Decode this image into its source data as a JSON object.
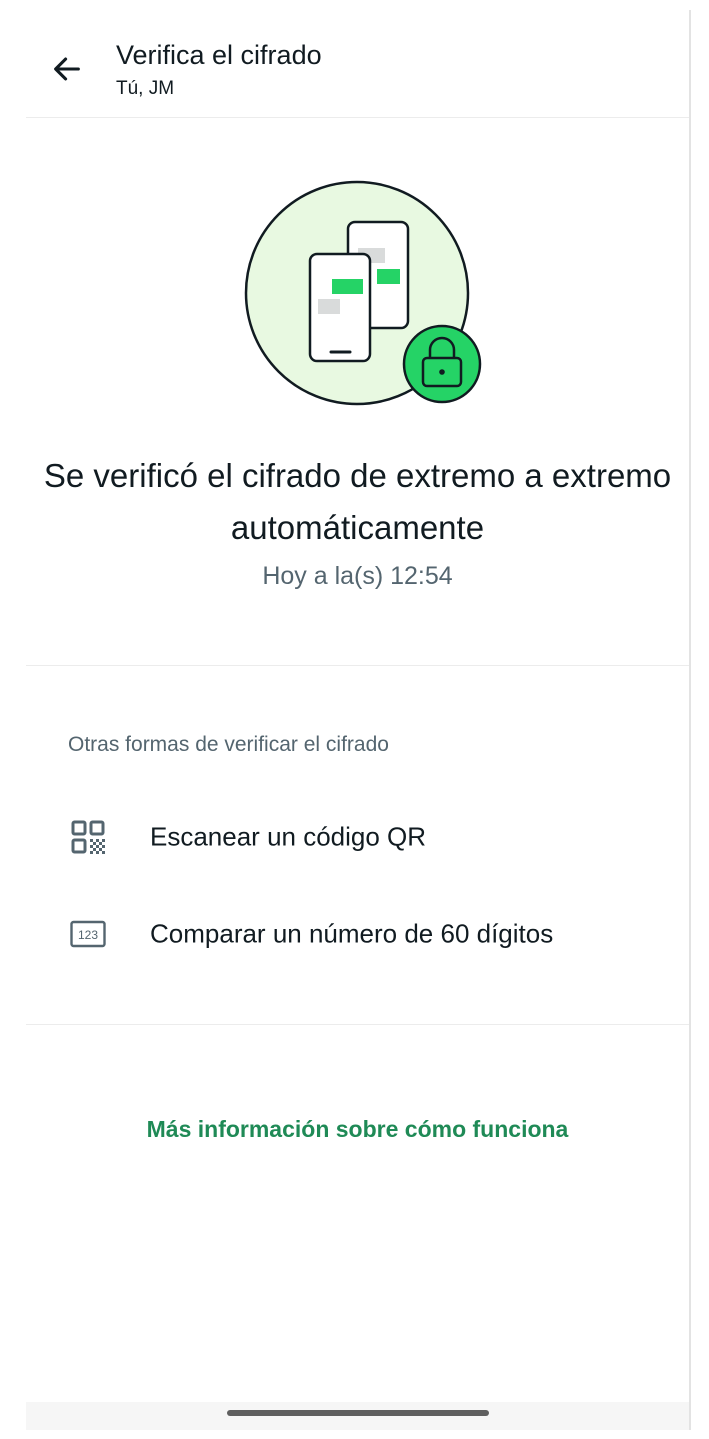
{
  "header": {
    "title": "Verifica el cifrado",
    "subtitle": "Tú, JM",
    "back_icon": "arrow-left-icon"
  },
  "illustration": {
    "icons": [
      "two-phones-icon",
      "padlock-icon"
    ],
    "colors": {
      "circle_fill": "#e8f9e1",
      "accent_green": "#25d366",
      "outline": "#111b21",
      "bubble_gray": "#d9dbdb"
    }
  },
  "status": {
    "heading": "Se verificó el cifrado de extremo a extremo automáticamente",
    "timestamp": "Hoy a la(s) 12:54"
  },
  "other_methods": {
    "section_label": "Otras formas de verificar el cifrado",
    "options": [
      {
        "label": "Escanear un código QR",
        "icon": "qr-code-icon"
      },
      {
        "label": "Comparar un número de 60 dígitos",
        "icon": "number-123-icon",
        "icon_text": "123"
      }
    ]
  },
  "footer": {
    "learn_more": "Más información sobre cómo funciona",
    "link_color": "#1f8a56"
  }
}
